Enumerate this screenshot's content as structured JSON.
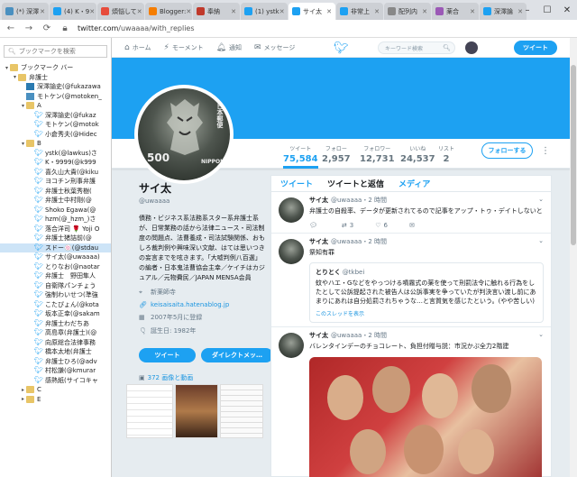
{
  "browser": {
    "tabs": [
      {
        "label": "(*) 深澤",
        "fav": "#4a90c0"
      },
      {
        "label": "(4) K・9",
        "fav": "#1da1f2"
      },
      {
        "label": "煩悩して",
        "fav": "#e74c3c"
      },
      {
        "label": "Blogger:",
        "fav": "#f57d00"
      },
      {
        "label": "奉納",
        "fav": "#c0392b"
      },
      {
        "label": "(1) ystk",
        "fav": "#1da1f2"
      },
      {
        "label": "サイ太",
        "fav": "#1da1f2",
        "active": true
      },
      {
        "label": "非常上",
        "fav": "#1da1f2"
      },
      {
        "label": "配列内",
        "fav": "#888888"
      },
      {
        "label": "薬合",
        "fav": "#9b59b6"
      },
      {
        "label": "深澤論",
        "fav": "#1da1f2"
      }
    ],
    "url_prefix": "twitter.com",
    "url_path": "/uwaaaa/with_replies"
  },
  "bookmarks": {
    "search_placeholder": "ブックマークを検索",
    "items": [
      {
        "label": "ブックマーク バー",
        "level": 0,
        "type": "folder",
        "open": true
      },
      {
        "label": "弁護士",
        "level": 1,
        "type": "folder",
        "open": true
      },
      {
        "label": "深澤諭史(@fukazawa",
        "level": 2,
        "type": "page"
      },
      {
        "label": "モトケン(@motoken_",
        "level": 2,
        "type": "page2"
      },
      {
        "label": "A",
        "level": 2,
        "type": "folder",
        "open": true
      },
      {
        "label": "深澤諭史(@fukaz",
        "level": 3,
        "type": "bird"
      },
      {
        "label": "モトケン(@motok",
        "level": 3,
        "type": "bird"
      },
      {
        "label": "小倉秀夫(@Hidec",
        "level": 3,
        "type": "bird"
      },
      {
        "label": "B",
        "level": 2,
        "type": "folder",
        "open": true
      },
      {
        "label": "ystk(@lawkus)さ",
        "level": 3,
        "type": "bird"
      },
      {
        "label": "K・9999(@k999",
        "level": 3,
        "type": "bird"
      },
      {
        "label": "喜久山大貴(@kiku",
        "level": 3,
        "type": "bird"
      },
      {
        "label": "ヨコチン刑事弁護",
        "level": 3,
        "type": "bird"
      },
      {
        "label": "弁護士秋葉秀樹(",
        "level": 3,
        "type": "bird"
      },
      {
        "label": "弁護士中村剛(@",
        "level": 3,
        "type": "bird"
      },
      {
        "label": "Shoko Egawa(@",
        "level": 3,
        "type": "bird"
      },
      {
        "label": "hzm(@_hzm_)さ",
        "level": 3,
        "type": "bird"
      },
      {
        "label": "落合洋司 🌹 Yoji O",
        "level": 3,
        "type": "bird"
      },
      {
        "label": "弁護士猪詰前(@",
        "level": 3,
        "type": "bird"
      },
      {
        "label": "スドー🍥(@stdau",
        "level": 3,
        "type": "bird",
        "selected": true
      },
      {
        "label": "サイ太(@uwaaaa)",
        "level": 3,
        "type": "bird"
      },
      {
        "label": "とりなお(@naotar",
        "level": 3,
        "type": "bird"
      },
      {
        "label": "弁護士　野田隼人",
        "level": 3,
        "type": "bird"
      },
      {
        "label": "自衛隊パンチょう",
        "level": 3,
        "type": "bird"
      },
      {
        "label": "強制わいせつ(準強",
        "level": 3,
        "type": "bird"
      },
      {
        "label": "こたぴょん(@kota",
        "level": 3,
        "type": "bird"
      },
      {
        "label": "坂本正幸(@sakam",
        "level": 3,
        "type": "bird"
      },
      {
        "label": "弁護士わだちあ",
        "level": 3,
        "type": "bird"
      },
      {
        "label": "高島章(弁護士)(@",
        "level": 3,
        "type": "bird"
      },
      {
        "label": "向原総合法律事務",
        "level": 3,
        "type": "bird"
      },
      {
        "label": "橋本太地(弁護士",
        "level": 3,
        "type": "bird"
      },
      {
        "label": "弁護士ひろ(@adv",
        "level": 3,
        "type": "bird"
      },
      {
        "label": "村松謙(@kmurar",
        "level": 3,
        "type": "bird"
      },
      {
        "label": "感熱紙(サイコキャ",
        "level": 3,
        "type": "bird"
      },
      {
        "label": "C",
        "level": 2,
        "type": "folder",
        "open": false
      },
      {
        "label": "E",
        "level": 2,
        "type": "folder",
        "open": false
      }
    ]
  },
  "twitter_nav": {
    "home": "ホーム",
    "moments": "モーメント",
    "notifications": "通知",
    "messages": "メッセージ",
    "search_placeholder": "キーワード検索",
    "tweet_button": "ツイート"
  },
  "profile": {
    "name": "サイ太",
    "handle": "@uwaaaa",
    "bio": "債務・ビジネス系法務系スター系弁護士系が、日常業務の話から法律ニュース・司法制度の問題点、法曹養成・司法試験関係、おもしろ裁判例や興味深い文献、はては思いつきの妄言までを呟きます。「大嘘判例八百選」の編者・日本鬼法曹協会主幸／ケイチはカジュアル／元物費民／JAPAN MENSA会員",
    "location": "新薬師寺",
    "website": "keisaisaita.hatenablog.jp",
    "joined": "2007年5月に登録",
    "birthday": "誕生日: 1982年",
    "tweet_btn": "ツイート",
    "dm_btn": "ダイレクトメッ…",
    "media_label": "372 画像と動画",
    "stamp_num": "500",
    "stamp_brand": "NIPPON",
    "stamp_kanji": "日本郵便"
  },
  "stats": [
    {
      "label": "ツイート",
      "value": "75,584",
      "active": true
    },
    {
      "label": "フォロー",
      "value": "2,957"
    },
    {
      "label": "フォロワー",
      "value": "12,731"
    },
    {
      "label": "いいね",
      "value": "24,537"
    },
    {
      "label": "リスト",
      "value": "2"
    }
  ],
  "follow_btn": "フォローする",
  "timeline": {
    "tabs": [
      "ツイート",
      "ツイートと返信",
      "メディア"
    ],
    "tweets": [
      {
        "name": "サイ太",
        "meta": "@uwaaaa・2 時間",
        "text": "弁護士の自殺率、データが更新されてるので記事をアップ・トゥ・デイトしないと",
        "replies": "",
        "retweets": "3",
        "likes": "6"
      },
      {
        "name": "サイ太",
        "meta": "@uwaaaa・2 時間",
        "text": "祭知有罪",
        "quote_name": "とりとく",
        "quote_meta": "@tkbei",
        "quote_text": "蚊やハエ・Gなどをやっつける噴霧式の薬を使って刑罰法令に触れる行為をしたとして公訴提起された被告人は公訴事実を争っていたが判決言い渡し前にあまりにあれは自分処罰されちゃうな…と言質気を感じたという。(やや苦しい)",
        "quote_link": "このスレッドを表示"
      },
      {
        "name": "サイ太",
        "meta": "@uwaaaa・2 時間",
        "text": "バレンタインデーのチョコレート、負担付贈与説：市況かぶ全力2階建"
      }
    ]
  }
}
